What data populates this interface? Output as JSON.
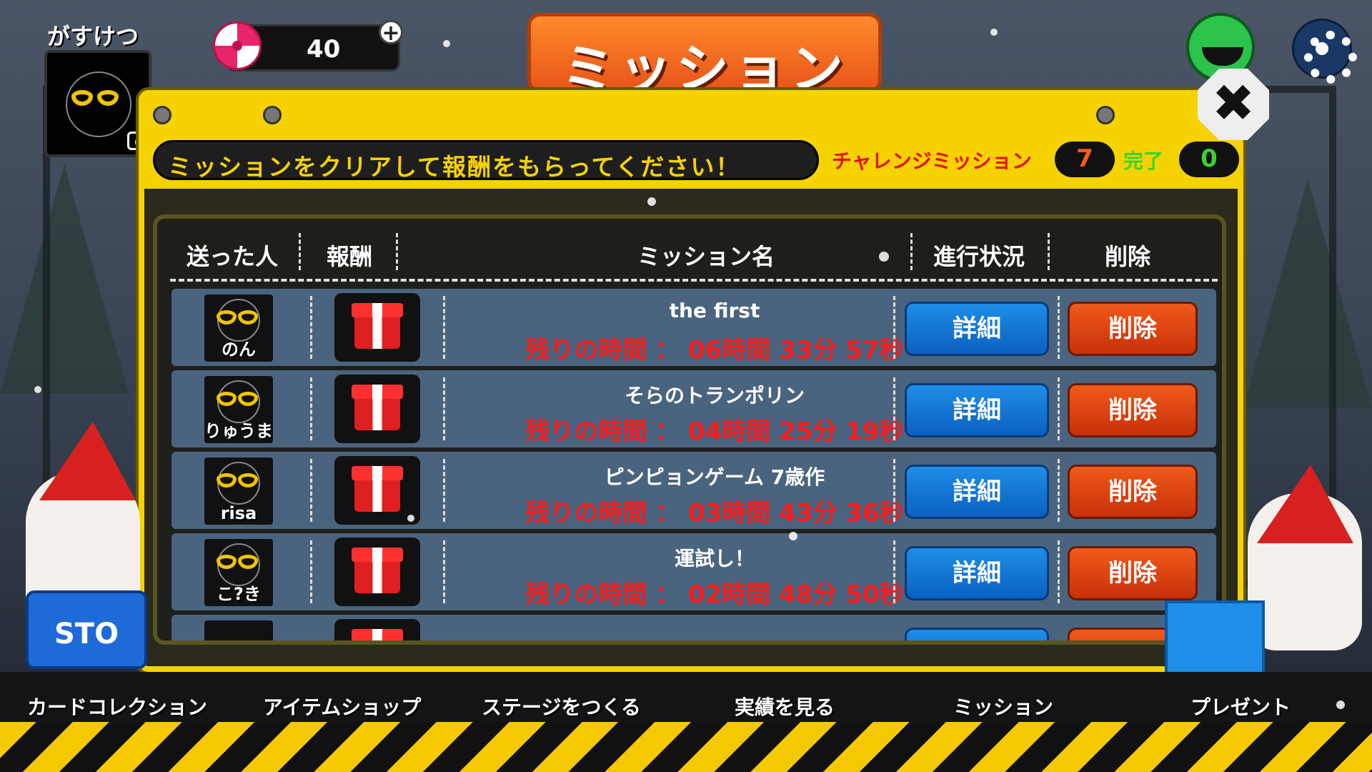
{
  "player": {
    "name": "がすけつ",
    "candy_count": "40",
    "plus_label": "+"
  },
  "title": "ミッション",
  "close_label": "✖",
  "instruction": "ミッションをクリアして報酬をもらってください！",
  "challenge": {
    "label": "チャレンジミッション",
    "count": "7",
    "done_label": "完了",
    "done_count": "0"
  },
  "table": {
    "headers": {
      "sender": "送った人",
      "reward": "報酬",
      "mission": "ミッション名",
      "progress": "進行状況",
      "delete": "削除"
    },
    "rows": [
      {
        "sender": "のん",
        "mission": "the first",
        "time": "残りの時間 ： 06時間 33分 57秒",
        "detail": "詳細",
        "delete": "削除"
      },
      {
        "sender": "りゅうま",
        "mission": "そらのトランポリン",
        "time": "残りの時間 ： 04時間 25分 19秒",
        "detail": "詳細",
        "delete": "削除"
      },
      {
        "sender": "risa",
        "mission": "ピンピョンゲーム 7歳作",
        "time": "残りの時間 ： 03時間 43分 36秒",
        "detail": "詳細",
        "delete": "削除"
      },
      {
        "sender": "こ?き",
        "mission": "運試し！",
        "time": "残りの時間 ： 02時間 48分 50秒",
        "detail": "詳細",
        "delete": "削除"
      }
    ]
  },
  "nav": {
    "card_collection": "カードコレクション",
    "item_shop": "アイテムショップ",
    "make_stage": "ステージをつくる",
    "achievements": "実績を見る",
    "mission": "ミッション",
    "present": "プレゼント"
  },
  "store_sign": "STO",
  "icons": [
    "camera-icon",
    "candy-icon",
    "plus-icon",
    "gear-icon",
    "close-icon",
    "gift-icon",
    "glasses-avatar-icon"
  ],
  "colors": {
    "panel_yellow": "#f5d200",
    "title_orange": "#ff8a2a",
    "detail_blue": "#1e8ee8",
    "delete_orange": "#e8451a",
    "time_red": "#ff1a1a",
    "done_green": "#3ad22a"
  }
}
